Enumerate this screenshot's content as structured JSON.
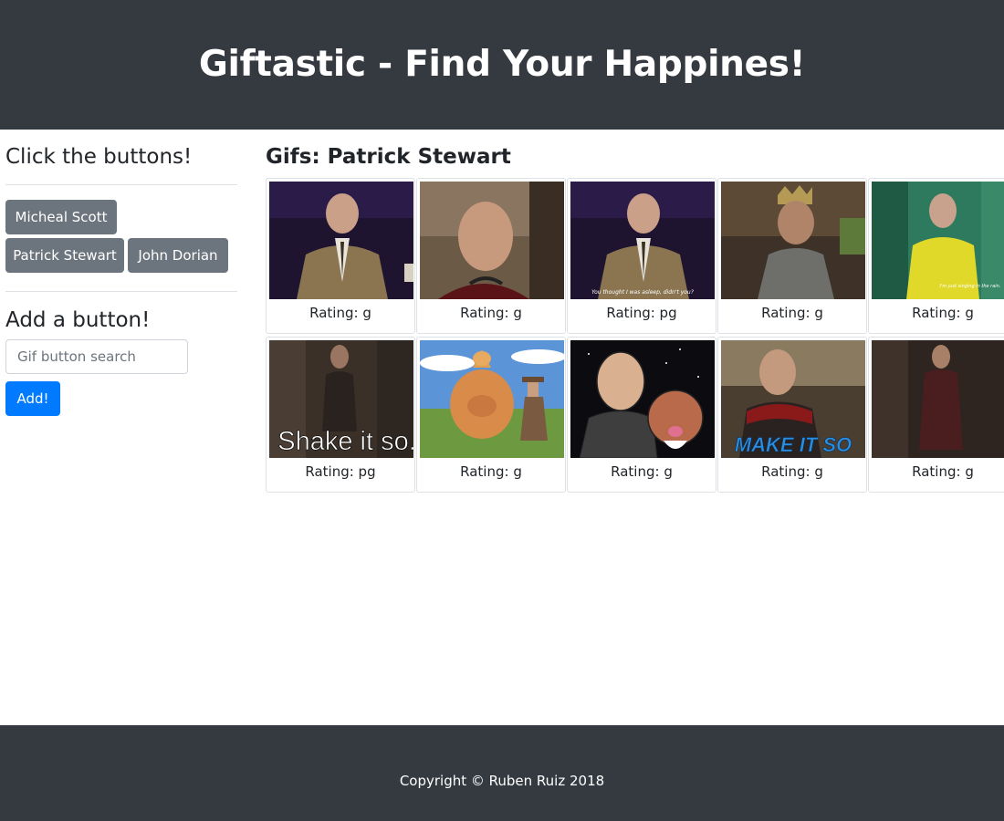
{
  "header": {
    "title": "Giftastic - Find Your Happines!"
  },
  "sidebar": {
    "buttons_heading": "Click the buttons!",
    "buttons": [
      {
        "label": "Micheal Scott"
      },
      {
        "label": "Patrick Stewart"
      },
      {
        "label": "John Dorian"
      }
    ],
    "add_heading": "Add a button!",
    "search_placeholder": "Gif button search",
    "add_label": "Add!"
  },
  "main": {
    "title": "Gifs: Patrick Stewart",
    "gifs": [
      {
        "rating": "Rating: g",
        "caption": ""
      },
      {
        "rating": "Rating: g",
        "caption": ""
      },
      {
        "rating": "Rating: pg",
        "caption": "You thought I was asleep, didn't you?"
      },
      {
        "rating": "Rating: g",
        "caption": ""
      },
      {
        "rating": "Rating: g",
        "caption": "I'm just singing in the rain."
      },
      {
        "rating": "Rating: pg",
        "caption": "Shake it so."
      },
      {
        "rating": "Rating: g",
        "caption": ""
      },
      {
        "rating": "Rating: g",
        "caption": ""
      },
      {
        "rating": "Rating: g",
        "caption": "MAKE IT SO"
      },
      {
        "rating": "Rating: g",
        "caption": ""
      }
    ]
  },
  "footer": {
    "copyright": "Copyright © Ruben Ruiz 2018"
  },
  "colors": {
    "dark": "#343a40",
    "secondary": "#6c757d",
    "primary": "#007bff",
    "border": "#dee2e6"
  }
}
